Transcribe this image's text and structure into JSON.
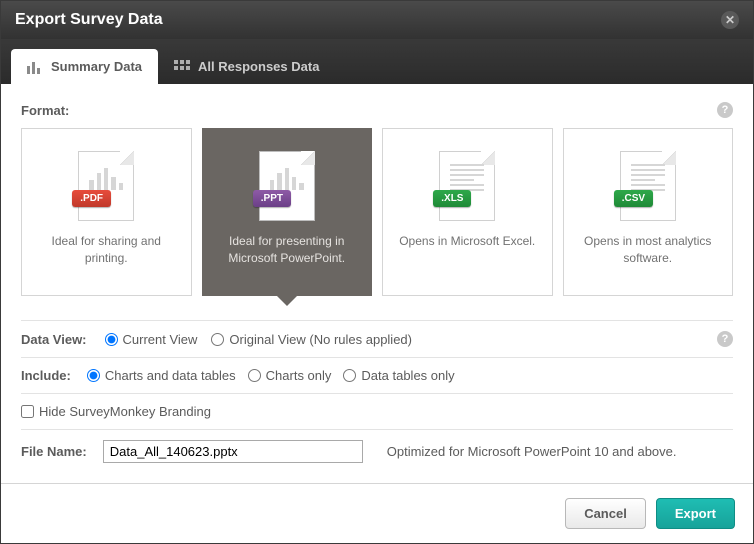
{
  "dialog": {
    "title": "Export Survey Data"
  },
  "tabs": {
    "summary": "Summary Data",
    "all_responses": "All Responses Data"
  },
  "format": {
    "label": "Format:",
    "cards": {
      "pdf": {
        "badge": ".PDF",
        "desc": "Ideal for sharing and printing."
      },
      "ppt": {
        "badge": ".PPT",
        "desc": "Ideal for presenting in Microsoft PowerPoint."
      },
      "xls": {
        "badge": ".XLS",
        "desc": "Opens in Microsoft Excel."
      },
      "csv": {
        "badge": ".CSV",
        "desc": "Opens in most analytics software."
      }
    }
  },
  "dataview": {
    "label": "Data View:",
    "current": "Current View",
    "original": "Original View (No rules applied)"
  },
  "include": {
    "label": "Include:",
    "both": "Charts and data tables",
    "charts": "Charts only",
    "tables": "Data tables only"
  },
  "hide_branding": "Hide SurveyMonkey Branding",
  "filename": {
    "label": "File Name:",
    "value": "Data_All_140623.pptx",
    "note": "Optimized for Microsoft PowerPoint 10 and above."
  },
  "buttons": {
    "cancel": "Cancel",
    "export": "Export"
  }
}
